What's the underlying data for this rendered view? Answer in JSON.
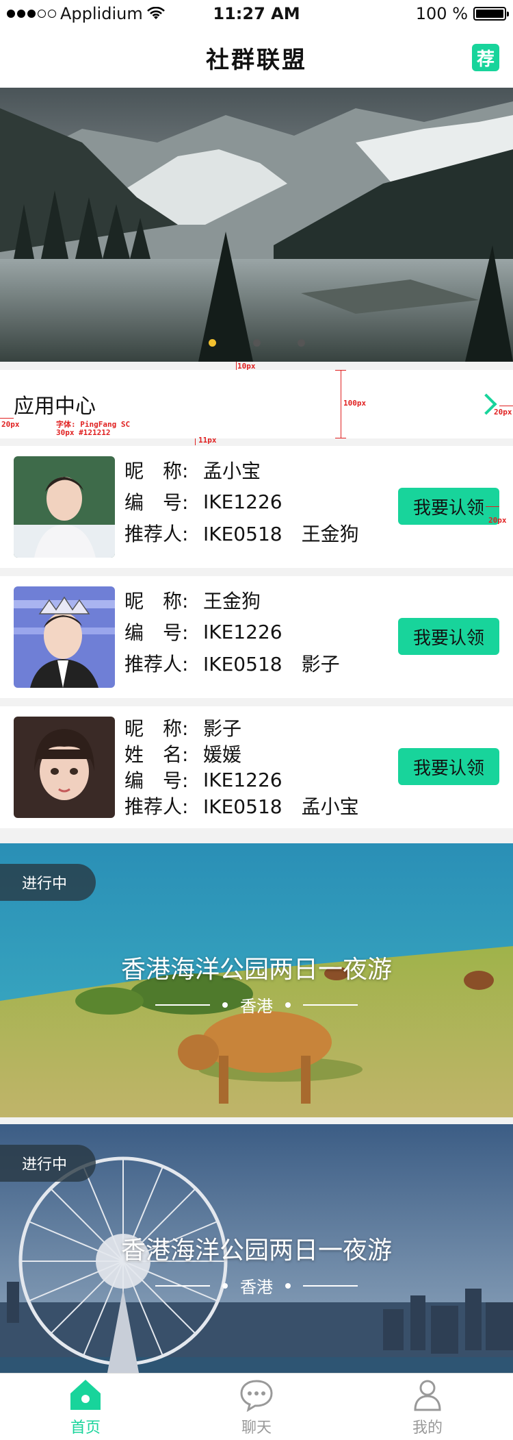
{
  "status_bar": {
    "carrier": "Applidium",
    "time": "11:27 AM",
    "battery": "100 %",
    "battery_level": 1.0,
    "signal_bars_on": 3,
    "signal_bars_total": 5
  },
  "nav": {
    "title": "社群联盟",
    "recommend_label": "荐"
  },
  "banner": {
    "page_count": 3,
    "active_index": 0
  },
  "app_center": {
    "title": "应用中心"
  },
  "annotations": {
    "a10": "10px",
    "a100": "100px",
    "a20left": "20px",
    "a20right": "20px",
    "a20btn": "20px",
    "a11": "11px",
    "font1": "字体: PingFang SC",
    "font2": "30px #121212"
  },
  "members": [
    {
      "rows": [
        {
          "label": "昵　称:",
          "value": "孟小宝"
        },
        {
          "label": "编　号:",
          "value": "IKE1226"
        },
        {
          "label": "推荐人:",
          "value": "IKE0518　王金狗"
        }
      ],
      "button": "我要认领"
    },
    {
      "rows": [
        {
          "label": "昵　称:",
          "value": "王金狗"
        },
        {
          "label": "编　号:",
          "value": "IKE1226"
        },
        {
          "label": "推荐人:",
          "value": "IKE0518　影子"
        }
      ],
      "button": "我要认领"
    },
    {
      "rows": [
        {
          "label": "昵　称:",
          "value": "影子"
        },
        {
          "label": "姓　名:",
          "value": "媛媛"
        },
        {
          "label": "编　号:",
          "value": "IKE1226"
        },
        {
          "label": "推荐人:",
          "value": "IKE0518　孟小宝"
        }
      ],
      "button": "我要认领"
    }
  ],
  "events": [
    {
      "badge": "进行中",
      "title": "香港海洋公园两日一夜游",
      "location": "香港"
    },
    {
      "badge": "进行中",
      "title": "香港海洋公园两日一夜游",
      "location": "香港"
    }
  ],
  "tabs": [
    {
      "label": "首页",
      "icon": "home-icon",
      "active": true
    },
    {
      "label": "聊天",
      "icon": "chat-icon",
      "active": false
    },
    {
      "label": "我的",
      "icon": "profile-icon",
      "active": false
    }
  ],
  "colors": {
    "accent": "#18d49b",
    "text": "#121212",
    "background": "#f2f2f2",
    "annotation": "#e02020"
  }
}
